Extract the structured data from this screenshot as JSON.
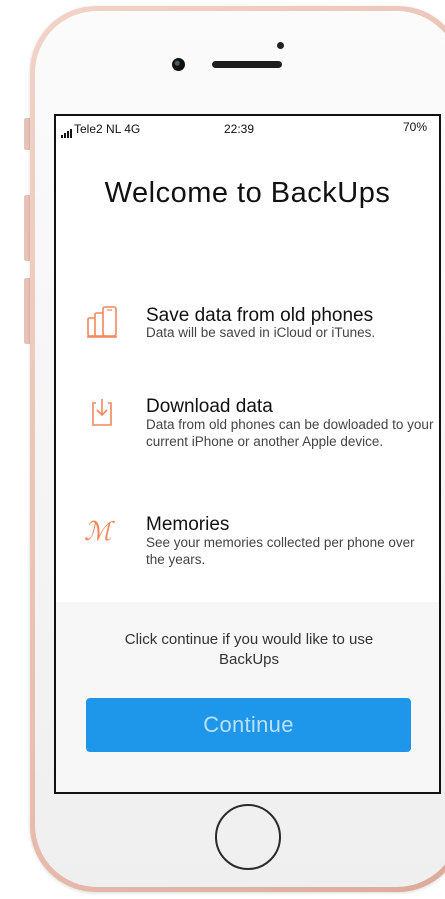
{
  "status_bar": {
    "carrier": "Tele2 NL 4G",
    "time": "22:39",
    "battery": "70%"
  },
  "title": "Welcome to BackUps",
  "features": [
    {
      "icon": "phones-icon",
      "title": "Save data from old phones",
      "description": "Data will be saved in iCloud or iTunes."
    },
    {
      "icon": "download-icon",
      "title": "Download data",
      "description": "Data from old phones can be dowloaded to your current iPhone or another Apple device."
    },
    {
      "icon": "memories-icon",
      "icon_glyph": "ℳ",
      "title": "Memories",
      "description": "See your memories collected per phone over the years."
    }
  ],
  "footer": {
    "text": "Click continue if you would like to use BackUps",
    "continue_label": "Continue"
  },
  "colors": {
    "accent_orange": "#f2875d",
    "button_blue": "#1e96ea",
    "button_text": "#b9e0fa",
    "frame_rose": "#e9bcae"
  }
}
